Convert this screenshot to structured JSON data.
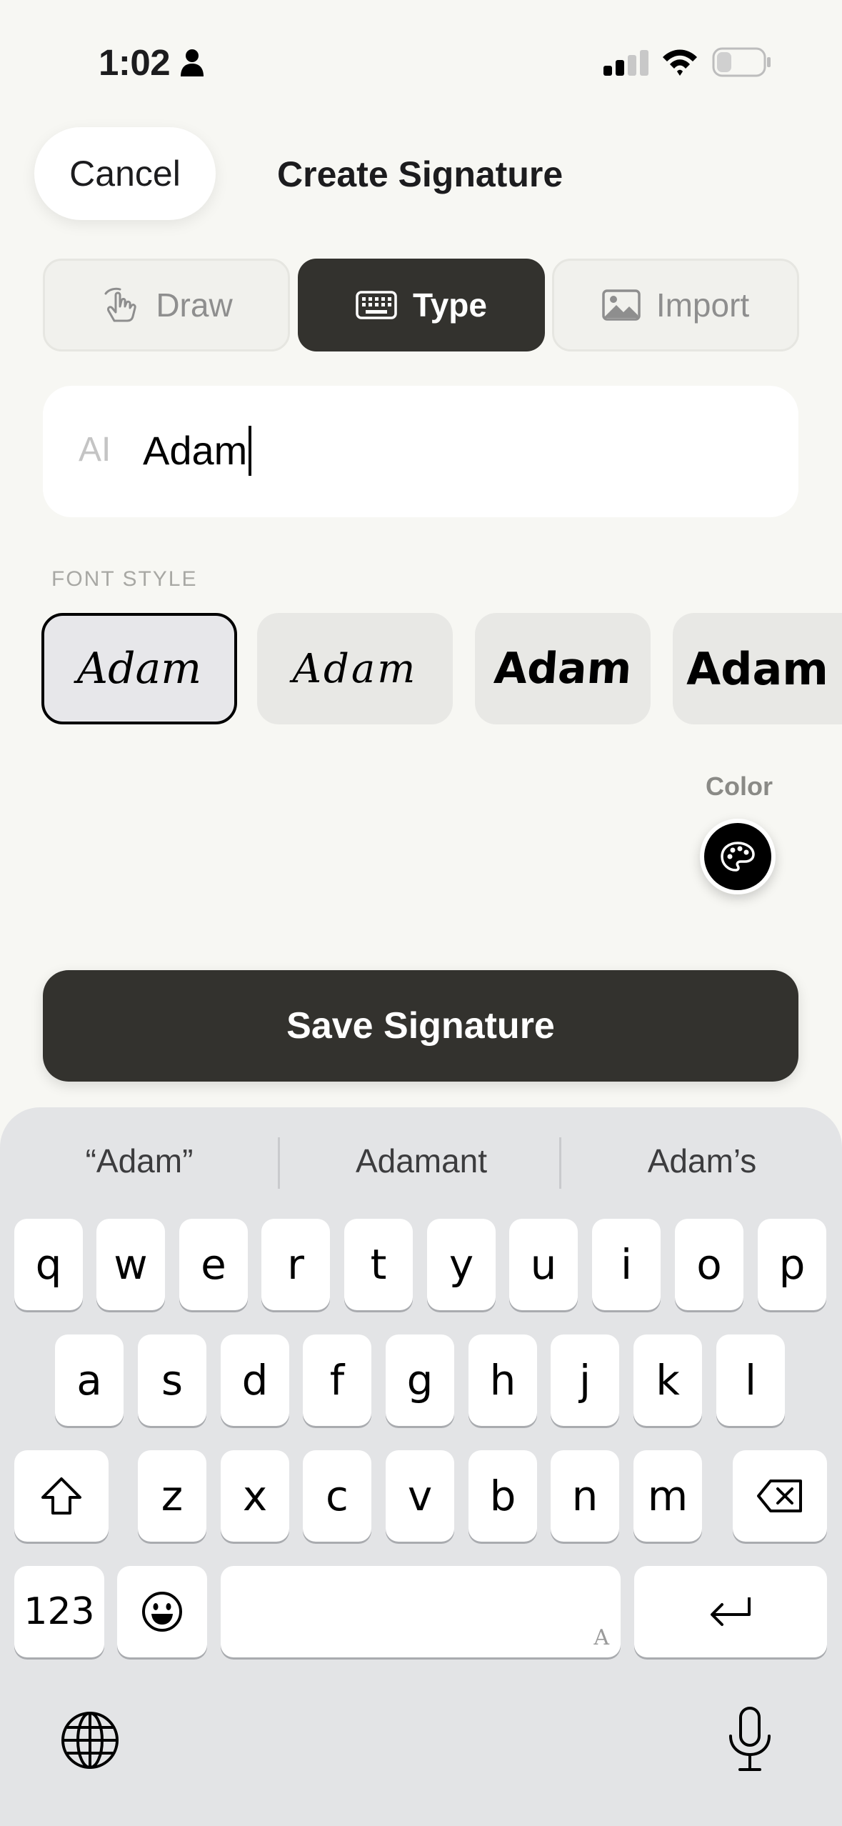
{
  "status_bar": {
    "time": "1:02"
  },
  "header": {
    "cancel_label": "Cancel",
    "title": "Create Signature"
  },
  "tabs": [
    {
      "label": "Draw",
      "icon": "hand-draw-icon",
      "active": false
    },
    {
      "label": "Type",
      "icon": "keyboard-icon",
      "active": true
    },
    {
      "label": "Import",
      "icon": "image-icon",
      "active": false
    }
  ],
  "name_input": {
    "value": "Adam",
    "icon": "text-cursor-icon"
  },
  "font_style": {
    "label": "FONT STYLE",
    "options": [
      {
        "sample": "Adam",
        "selected": true
      },
      {
        "sample": "Adam",
        "selected": false
      },
      {
        "sample": "Adam",
        "selected": false
      },
      {
        "sample": "Adam",
        "selected": false
      }
    ]
  },
  "color": {
    "label": "Color",
    "icon": "palette-icon",
    "value": "#000000"
  },
  "save_label": "Save Signature",
  "keyboard": {
    "suggestions": [
      "“Adam”",
      "Adamant",
      "Adam’s"
    ],
    "row1": [
      "q",
      "w",
      "e",
      "r",
      "t",
      "y",
      "u",
      "i",
      "o",
      "p"
    ],
    "row2": [
      "a",
      "s",
      "d",
      "f",
      "g",
      "h",
      "j",
      "k",
      "l"
    ],
    "row3": [
      "z",
      "x",
      "c",
      "v",
      "b",
      "n",
      "m"
    ],
    "numbers_label": "123",
    "space_hint": "A"
  },
  "colors": {
    "background": "#f7f7f3",
    "accent_dark": "#33322e",
    "keyboard_bg": "#e3e4e6"
  }
}
